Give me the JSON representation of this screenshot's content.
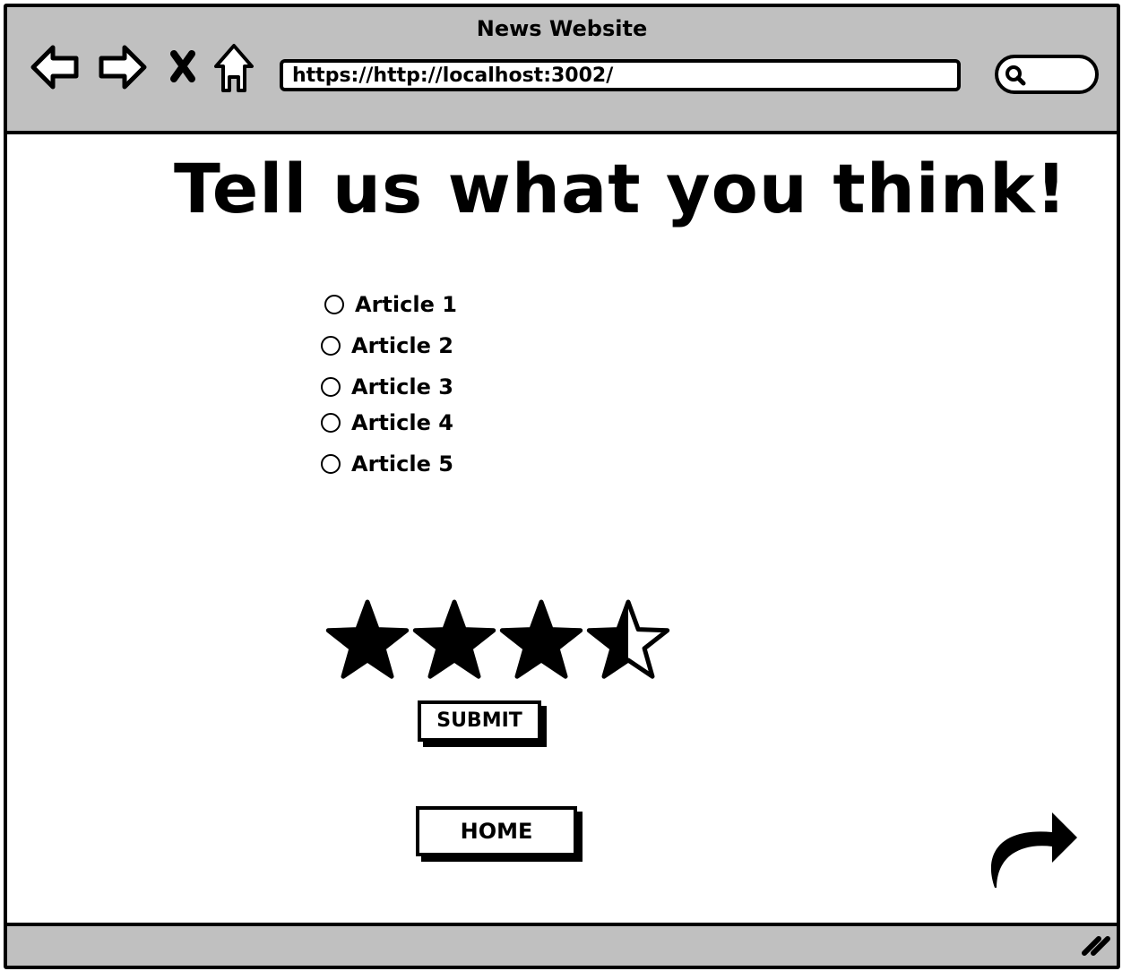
{
  "window": {
    "title": "News Website"
  },
  "browser": {
    "address": "https://http://localhost:3002/",
    "icons": [
      "back-arrow-icon",
      "forward-arrow-icon",
      "close-icon",
      "home-icon",
      "search-icon"
    ]
  },
  "page": {
    "heading": "Tell us what you think!",
    "articles": [
      {
        "label": "Article 1",
        "selected": false
      },
      {
        "label": "Article 2",
        "selected": false
      },
      {
        "label": "Article 3",
        "selected": false
      },
      {
        "label": "Article 4",
        "selected": false
      },
      {
        "label": "Article 5",
        "selected": false
      }
    ],
    "rating": {
      "value": 3.5,
      "max": 4
    },
    "submit_label": "SUBMIT",
    "home_label": "HOME",
    "share_icon": "share-icon"
  },
  "statusbar": {
    "resize_icon": "resize-grip-icon"
  }
}
